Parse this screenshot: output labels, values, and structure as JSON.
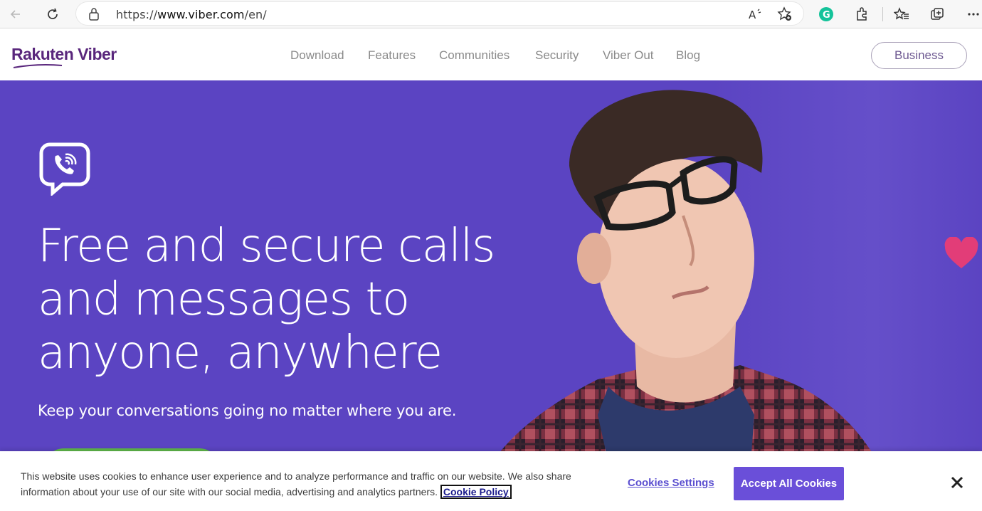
{
  "browser": {
    "url_prefix": "https://",
    "url_host": "www.viber.com",
    "url_path": "/en/"
  },
  "nav": {
    "logo": "Rakuten Viber",
    "links": [
      "Download",
      "Features",
      "Communities",
      "Security",
      "Viber Out",
      "Blog"
    ],
    "business_button": "Business"
  },
  "hero": {
    "headline_lines": [
      "Free and secure calls",
      "and messages to",
      "anyone, anywhere"
    ],
    "subline": "Keep your conversations going no matter where you are."
  },
  "cookie": {
    "text": "This website uses cookies to enhance user experience and to analyze performance and traffic on our website. We also share information about your use of our site with our social media, advertising and analytics partners.",
    "policy_link": "Cookie Policy",
    "settings_label": "Cookies Settings",
    "accept_label": "Accept All Cookies"
  },
  "colors": {
    "hero_bg": "#5b44c2",
    "brand_purple": "#59267c",
    "accept_bg": "#6a4fd9",
    "cta_green": "#5fb84a",
    "grammarly_green": "#15c39a"
  },
  "icons": [
    "back-arrow-icon",
    "refresh-icon",
    "lock-icon",
    "read-aloud-icon",
    "favorite-add-icon",
    "grammarly-icon",
    "extensions-icon",
    "favorites-icon",
    "collections-icon",
    "more-icon",
    "viber-phone-icon",
    "heart-icon",
    "close-icon"
  ]
}
